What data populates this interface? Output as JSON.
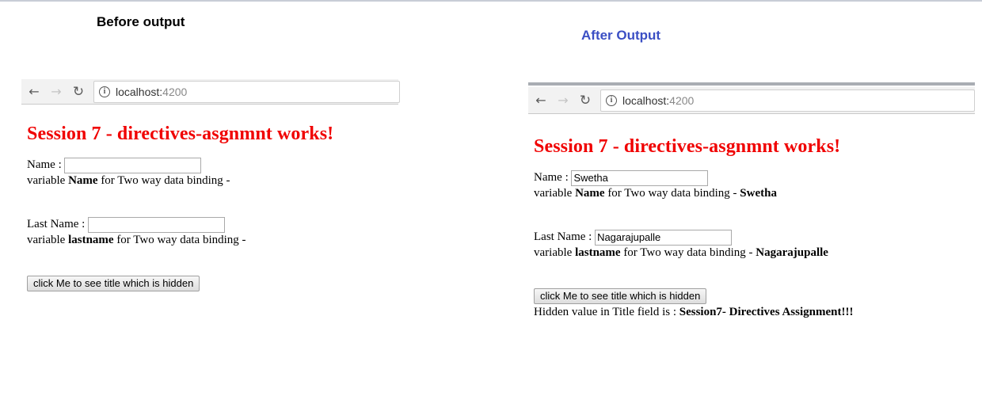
{
  "captions": {
    "before": "Before output",
    "after": "After Output"
  },
  "browser": {
    "url_host": "localhost:",
    "url_port": "4200"
  },
  "page": {
    "heading": "Session 7 - directives-asgnmnt works!",
    "name_label": "Name :",
    "name_var_prefix": "variable",
    "name_var_bold": "Name",
    "name_var_suffix": "for Two way data binding -",
    "lastname_label": "Last Name :",
    "lastname_var_prefix": "variable",
    "lastname_var_bold": "lastname",
    "lastname_var_suffix": "for Two way data binding -",
    "button_label": "click Me to see title which is hidden",
    "hidden_label": "Hidden value in Title field is :"
  },
  "before": {
    "name_value": "",
    "lastname_value": ""
  },
  "after": {
    "name_value": "Swetha",
    "lastname_value": "Nagarajupalle",
    "hidden_value": "Session7- Directives Assignment!!!"
  },
  "colors": {
    "heading": "#f00000",
    "after_caption": "#3b4fc4"
  }
}
